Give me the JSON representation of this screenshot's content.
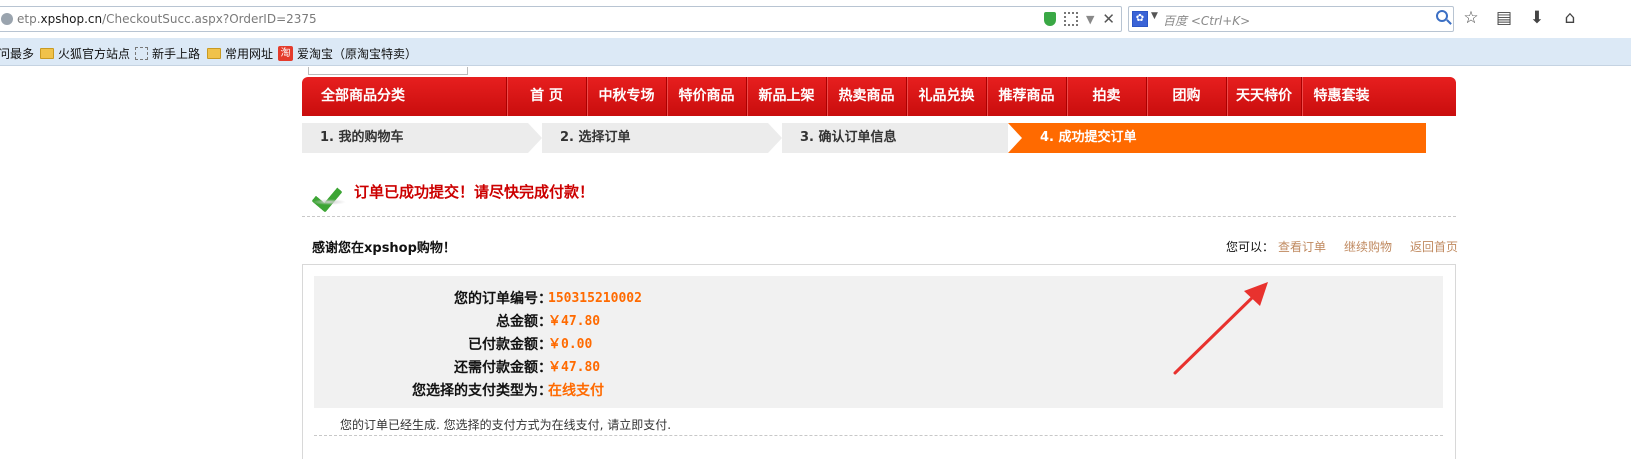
{
  "browser": {
    "url_prefix": "etp.",
    "url_host": "xpshop.cn",
    "url_path": "/CheckoutSucc.aspx?OrderID=2375",
    "search_placeholder": "百度 <Ctrl+K>",
    "engine_icon": "baidu-paw-icon",
    "bookmarks": [
      {
        "label": "问最多",
        "icon": ""
      },
      {
        "label": "火狐官方站点",
        "icon": "folder-icon"
      },
      {
        "label": "新手上路",
        "icon": "page-icon"
      },
      {
        "label": "常用网址",
        "icon": "folder-icon"
      },
      {
        "label": "爱淘宝（原淘宝特卖）",
        "icon": "taobao-icon"
      }
    ],
    "taobao_glyph": "淘"
  },
  "nav": {
    "all_categories": "全部商品分类",
    "items": [
      "首 页",
      "中秋专场",
      "特价商品",
      "新品上架",
      "热卖商品",
      "礼品兑换",
      "推荐商品",
      "拍卖",
      "团购",
      "天天特价",
      "特惠套装"
    ]
  },
  "steps": [
    {
      "label": "1. 我的购物车",
      "active": false
    },
    {
      "label": "2. 选择订单",
      "active": false
    },
    {
      "label": "3. 确认订单信息",
      "active": false
    },
    {
      "label": "4. 成功提交订单",
      "active": true
    }
  ],
  "success_message": "订单已成功提交！请尽快完成付款！",
  "thanks": "感谢您在xpshop购物！",
  "actions": {
    "prefix": "您可以：",
    "links": [
      "查看订单",
      "继续购物",
      "返回首页"
    ]
  },
  "order": {
    "rows": [
      {
        "label": "您的订单编号：",
        "value": "150315210002"
      },
      {
        "label": "总金额：",
        "value": "￥47.80"
      },
      {
        "label": "已付款金额：",
        "value": "￥0.00"
      },
      {
        "label": "还需付款金额：",
        "value": "￥47.80"
      },
      {
        "label": "您选择的支付类型为：",
        "value": "在线支付"
      }
    ],
    "note": "您的订单已经生成. 您选择的支付方式为在线支付, 请立即支付."
  },
  "colors": {
    "nav_red": "#d41414",
    "step_active": "#ff6a00",
    "value_orange": "#ff6a00",
    "success_red": "#cc0000",
    "annotation_arrow": "#e8322e"
  }
}
